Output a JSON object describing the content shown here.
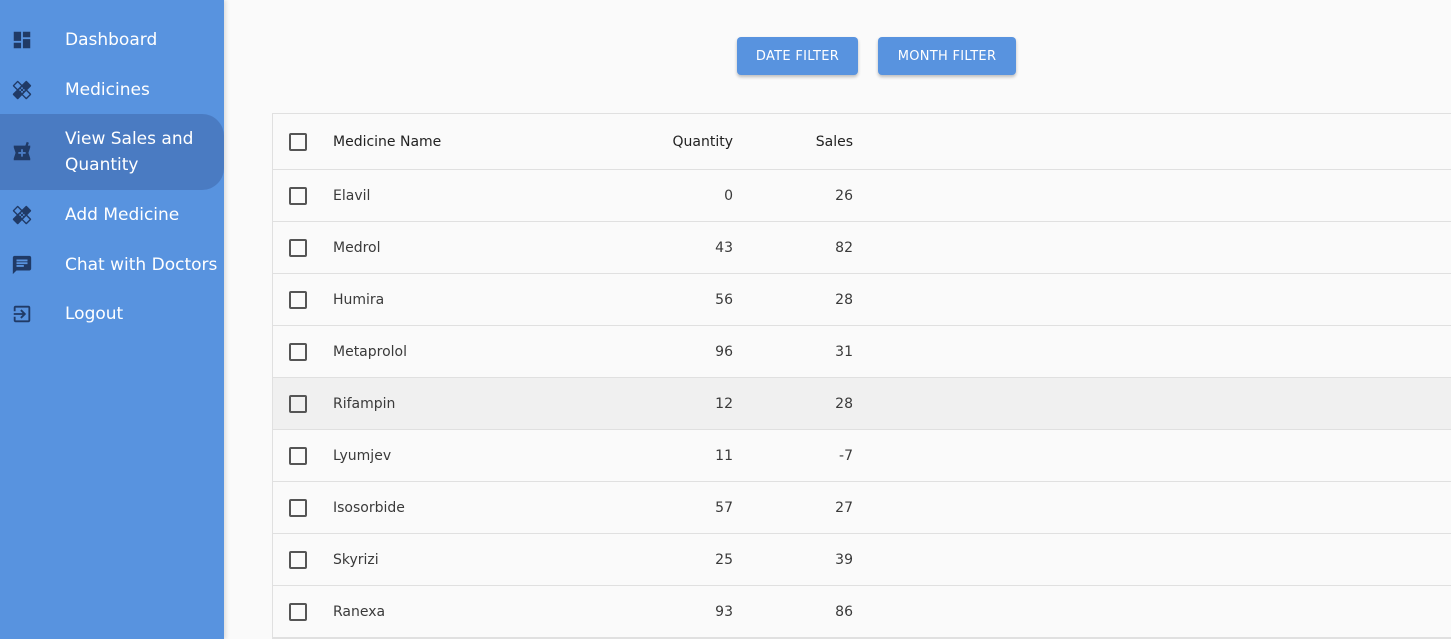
{
  "sidebar": {
    "items": [
      {
        "label": "Dashboard",
        "icon": "dashboard-icon"
      },
      {
        "label": "Medicines",
        "icon": "bandage-icon"
      },
      {
        "label": "View Sales and Quantity",
        "icon": "pharmacy-icon",
        "active": true
      },
      {
        "label": "Add Medicine",
        "icon": "bandage-icon"
      },
      {
        "label": "Chat with Doctors",
        "icon": "chat-icon"
      },
      {
        "label": "Logout",
        "icon": "logout-icon"
      }
    ]
  },
  "filters": {
    "date_label": "DATE FILTER",
    "month_label": "MONTH FILTER"
  },
  "table": {
    "columns": [
      "Medicine Name",
      "Quantity",
      "Sales"
    ],
    "rows": [
      {
        "name": "Elavil",
        "quantity": "0",
        "sales": "26"
      },
      {
        "name": "Medrol",
        "quantity": "43",
        "sales": "82"
      },
      {
        "name": "Humira",
        "quantity": "56",
        "sales": "28"
      },
      {
        "name": "Metaprolol",
        "quantity": "96",
        "sales": "31"
      },
      {
        "name": "Rifampin",
        "quantity": "12",
        "sales": "28"
      },
      {
        "name": "Lyumjev",
        "quantity": "11",
        "sales": "-7"
      },
      {
        "name": "Isosorbide",
        "quantity": "57",
        "sales": "27"
      },
      {
        "name": "Skyrizi",
        "quantity": "25",
        "sales": "39"
      },
      {
        "name": "Ranexa",
        "quantity": "93",
        "sales": "86"
      }
    ]
  },
  "colors": {
    "accent": "#5893df",
    "active_nav": "#4a7bc2",
    "icon": "#203a66"
  }
}
